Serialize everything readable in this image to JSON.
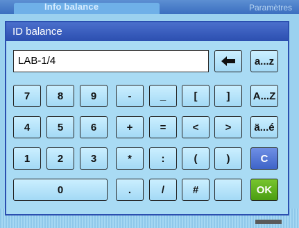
{
  "background": {
    "title": "Info balance",
    "right_text": "Paramètres"
  },
  "dialog": {
    "title": "ID balance",
    "input_value": "LAB-1/4"
  },
  "keys": {
    "backspace": "←",
    "case_lower": "a...z",
    "case_upper": "A...Z",
    "accents": "ä...é",
    "clear": "C",
    "ok": "OK",
    "row1": [
      "7",
      "8",
      "9",
      "-",
      "_",
      "[",
      "]"
    ],
    "row2": [
      "4",
      "5",
      "6",
      "+",
      "=",
      "<",
      ">"
    ],
    "row3": [
      "1",
      "2",
      "3",
      "*",
      ":",
      "(",
      ")"
    ],
    "row4": [
      "0",
      ".",
      "/",
      "#",
      ""
    ]
  },
  "colors": {
    "dialog_title_bg": "#2c4fb0",
    "ok_green": "#4a9d12",
    "clear_blue": "#3e64c8"
  }
}
